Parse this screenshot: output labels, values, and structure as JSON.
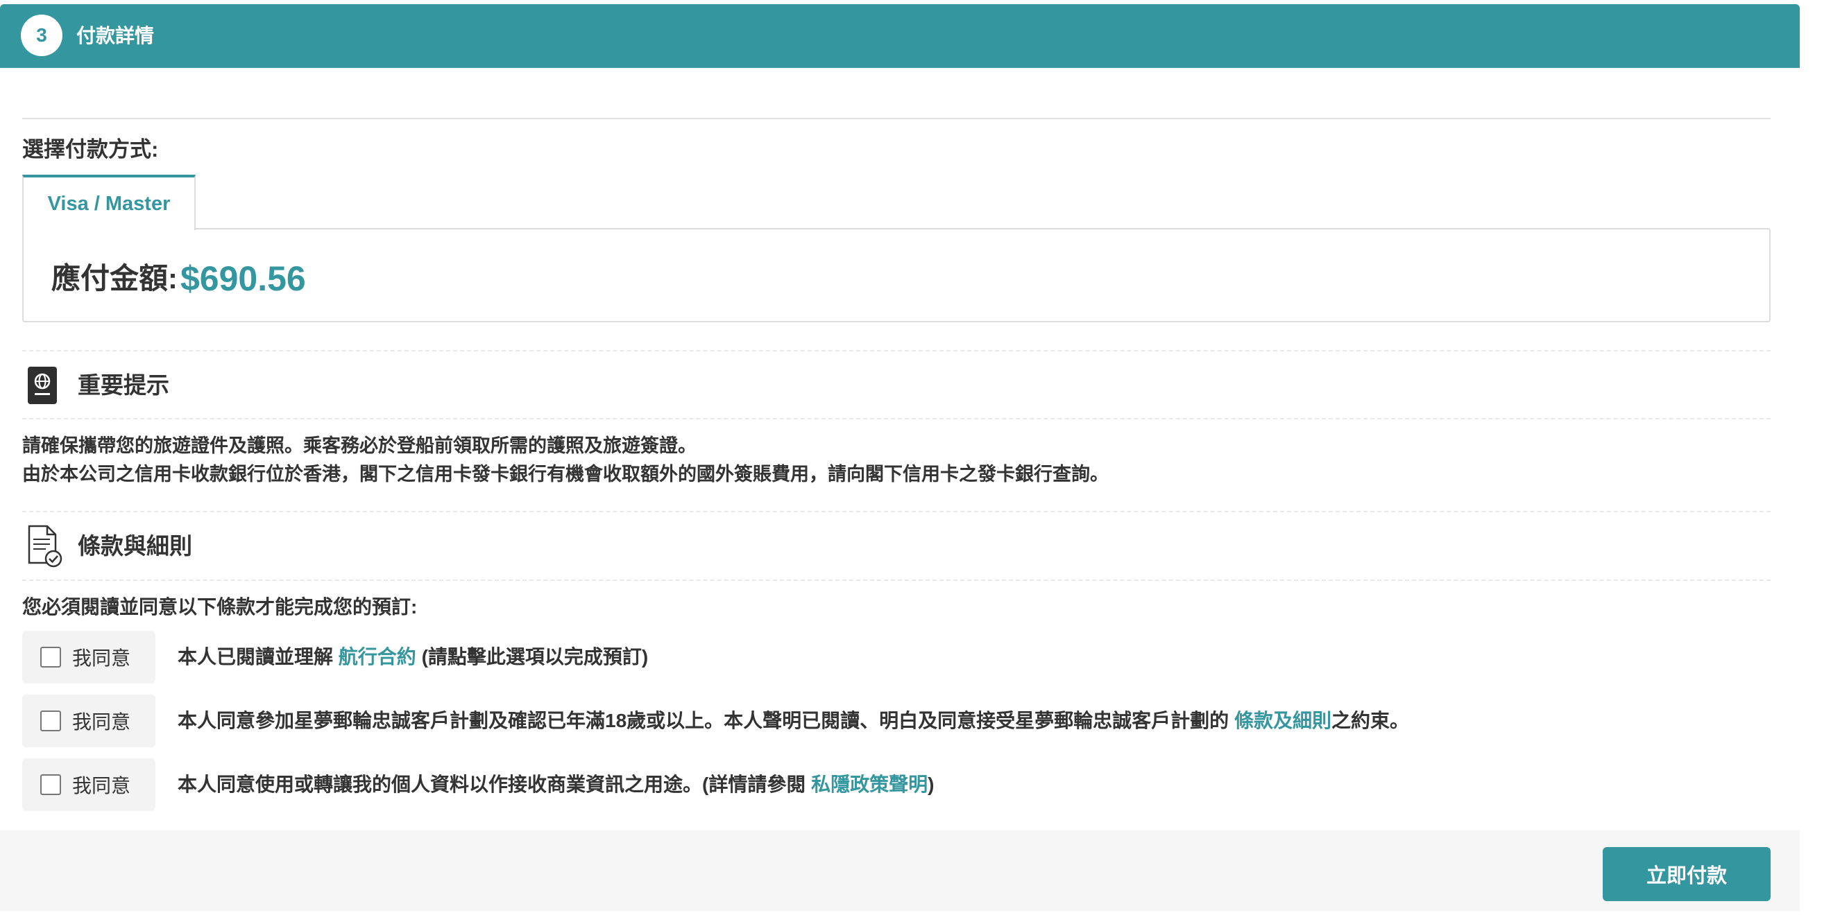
{
  "step": {
    "number": "3",
    "title": "付款詳情"
  },
  "payment": {
    "select_label": "選擇付款方式:",
    "tab_label": "Visa / Master",
    "amount_label": "應付金額:",
    "amount_value": "$690.56"
  },
  "notice": {
    "title": "重要提示",
    "icon": "passport-icon",
    "lines": [
      "請確保攜帶您的旅遊證件及護照。乘客務必於登船前領取所需的護照及旅遊簽證。",
      "由於本公司之信用卡收款銀行位於香港，閣下之信用卡發卡銀行有機會收取額外的國外簽賬費用，請向閣下信用卡之發卡銀行查詢。"
    ]
  },
  "terms": {
    "title": "條款與細則",
    "icon": "document-check-icon",
    "intro": "您必須閱讀並同意以下條款才能完成您的預訂:",
    "items": [
      {
        "agree_label": "我同意",
        "text_before": "本人已閱讀並理解 ",
        "link": "航行合約",
        "text_after": " (請點擊此選項以完成預訂)"
      },
      {
        "agree_label": "我同意",
        "text_before": "本人同意參加星夢郵輪忠誠客戶計劃及確認已年滿18歲或以上。本人聲明已閱讀、明白及同意接受星夢郵輪忠誠客戶計劃的 ",
        "link": "條款及細則",
        "text_after": "之約束。"
      },
      {
        "agree_label": "我同意",
        "text_before": "本人同意使用或轉讓我的個人資料以作接收商業資訊之用途。(詳情請參閱 ",
        "link": "私隱政策聲明",
        "text_after": ")"
      }
    ]
  },
  "footer": {
    "pay_button": "立即付款"
  },
  "colors": {
    "accent": "#34969f",
    "text": "#333333",
    "footer_bg": "#f5f5f5"
  }
}
